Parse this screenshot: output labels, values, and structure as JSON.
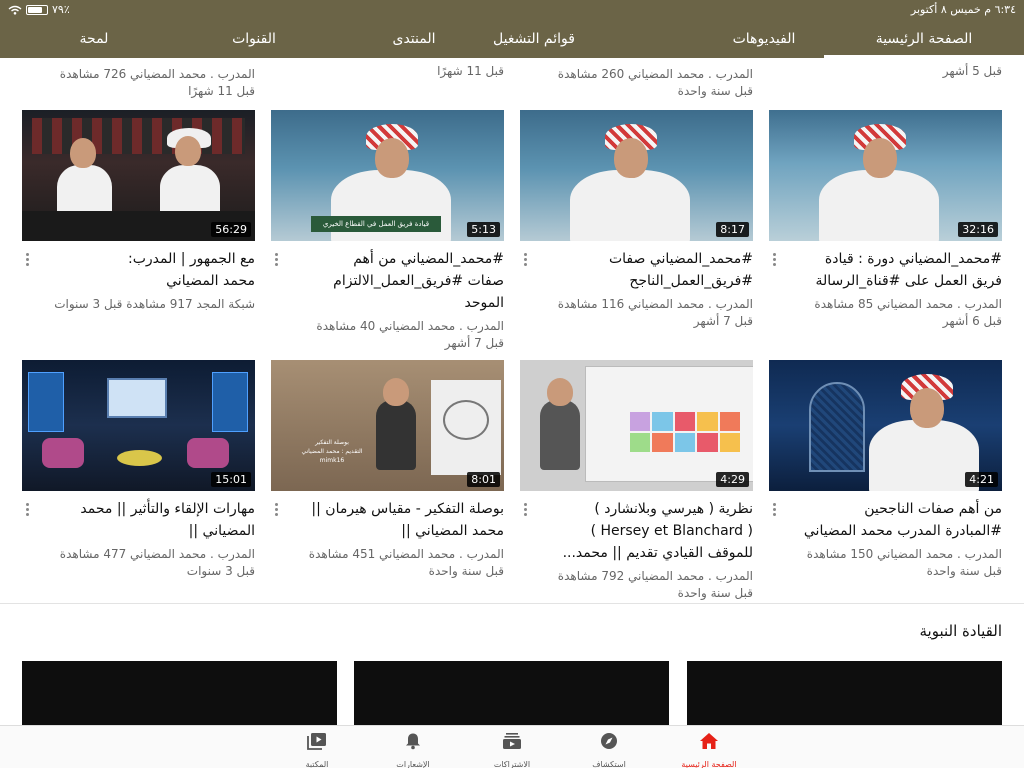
{
  "status_bar": {
    "time_date": "٦:٣٤ م  خميس ٨ أكتوبر",
    "battery": "٧٩٪",
    "battery_level": 0.79
  },
  "tabs": [
    {
      "label": "الصفحة الرئيسية",
      "active": true
    },
    {
      "label": "الفيديوهات",
      "active": false
    },
    {
      "label": "قوائم التشغيل",
      "active": false
    },
    {
      "label": "المنتدى",
      "active": false
    },
    {
      "label": "القنوات",
      "active": false
    },
    {
      "label": "لمحة",
      "active": false
    }
  ],
  "top_partial": [
    {
      "meta1": "قبل 5 أشهر",
      "meta2": ""
    },
    {
      "meta1": "المدرب . محمد المضياني  260 مشاهدة",
      "meta2": "قبل سنة واحدة"
    },
    {
      "meta1": "قبل 11 شهرًا",
      "meta2": ""
    },
    {
      "meta1": "المدرب . محمد المضياني  726 مشاهدة",
      "meta2": "قبل 11 شهرًا"
    }
  ],
  "row1": [
    {
      "title1": "#محمد_المضياني دورة : قيادة",
      "title2": "فريق العمل على #قناة_الرسالة",
      "title3": "",
      "meta1": "المدرب . محمد المضياني  85 مشاهدة",
      "meta2": "قبل 6 أشهر",
      "duration": "32:16"
    },
    {
      "title1": "#محمد_المضياني صفات",
      "title2": "#فريق_العمل_الناجح",
      "title3": "",
      "meta1": "المدرب . محمد المضياني  116 مشاهدة",
      "meta2": "قبل 7 أشهر",
      "duration": "8:17"
    },
    {
      "title1": "#محمد_المضياني من أهم",
      "title2": "صفات #فريق_العمل_الالتزام",
      "title3": "الموحد",
      "meta1": "المدرب . محمد المضياني  40 مشاهدة",
      "meta2": "قبل 7 أشهر",
      "duration": "5:13",
      "caption": "قيادة فريق العمل في القطاع الخيري"
    },
    {
      "title1": "مع الجمهور | المدرب:",
      "title2": "محمد المضياني",
      "title3": "",
      "meta1": "شبكة المجد  917 مشاهدة  قبل 3 سنوات",
      "meta2": "",
      "duration": "56:29"
    }
  ],
  "row2": [
    {
      "title1": "من أهم صفات الناجحين",
      "title2": "#المبادرة المدرب محمد المضياني",
      "meta1": "المدرب . محمد المضياني  150 مشاهدة",
      "meta2": "قبل سنة واحدة",
      "duration": "4:21"
    },
    {
      "title1": "نظرية ( هيرسي وبلانشارد )",
      "title2": "( Hersey et Blanchard )",
      "title3": "للموقف القيادي تقديم || محمد...",
      "meta1": "المدرب . محمد المضياني  792 مشاهدة",
      "meta2": "قبل سنة واحدة",
      "duration": "4:29"
    },
    {
      "title1": "بوصلة التفكير - مقياس هيرمان ||",
      "title2": "محمد المضياني ||",
      "meta1": "المدرب . محمد المضياني  451 مشاهدة",
      "meta2": "قبل سنة واحدة",
      "duration": "8:01",
      "caption": "بوصلة التفكير",
      "caption2": "التقديم : محمد المضياني",
      "handle": "mimk16"
    },
    {
      "title1": "مهارات الإلقاء والتأثير || محمد",
      "title2": "المضياني ||",
      "meta1": "المدرب . محمد المضياني  477 مشاهدة",
      "meta2": "قبل 3 سنوات",
      "duration": "15:01"
    }
  ],
  "section": {
    "title": "القيادة النبوية"
  },
  "bottom_nav": [
    {
      "label": "الصفحة الرئيسية",
      "icon": "home-icon",
      "active": true
    },
    {
      "label": "استكشاف",
      "icon": "compass-icon",
      "active": false
    },
    {
      "label": "الاشتراكات",
      "icon": "subscriptions-icon",
      "active": false
    },
    {
      "label": "الإشعارات",
      "icon": "bell-icon",
      "active": false
    },
    {
      "label": "المكتبة",
      "icon": "library-icon",
      "active": false
    }
  ],
  "colors": {
    "header": "#6b6447",
    "accent": "#e62117"
  }
}
